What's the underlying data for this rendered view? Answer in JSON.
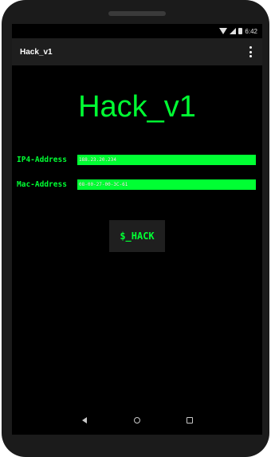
{
  "status_bar": {
    "time": "6:42"
  },
  "app_bar": {
    "title": "Hack_v1"
  },
  "main": {
    "title": "Hack_v1",
    "ip_field": {
      "label": "IP4-Address",
      "value": "188.23.20.234"
    },
    "mac_field": {
      "label": "Mac-Address",
      "value": "08-00-27-00-3C-61"
    },
    "hack_button_label": "$_HACK"
  },
  "colors": {
    "accent": "#00ff33",
    "background": "#000000",
    "app_bar": "#1e1e1e",
    "button": "#1f1f1f"
  },
  "icons": [
    "wifi-icon",
    "signal-icon",
    "battery-icon",
    "overflow-menu-icon",
    "back-icon",
    "home-icon",
    "recents-icon"
  ]
}
